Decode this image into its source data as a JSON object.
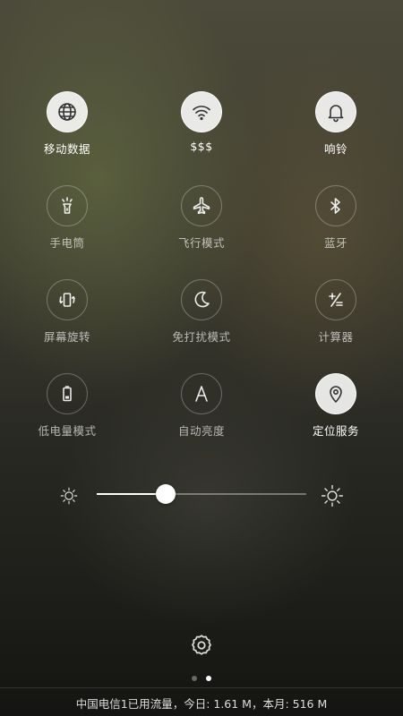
{
  "tiles": [
    {
      "label": "移动数据",
      "icon": "globe-icon",
      "on": true
    },
    {
      "label": "$$$",
      "icon": "wifi-icon",
      "on": true
    },
    {
      "label": "响铃",
      "icon": "bell-icon",
      "on": true
    },
    {
      "label": "手电筒",
      "icon": "flashlight-icon",
      "on": false
    },
    {
      "label": "飞行模式",
      "icon": "airplane-icon",
      "on": false
    },
    {
      "label": "蓝牙",
      "icon": "bluetooth-icon",
      "on": false
    },
    {
      "label": "屏幕旋转",
      "icon": "rotate-screen-icon",
      "on": false
    },
    {
      "label": "免打扰模式",
      "icon": "moon-icon",
      "on": false
    },
    {
      "label": "计算器",
      "icon": "calculator-icon",
      "on": false
    },
    {
      "label": "低电量模式",
      "icon": "battery-low-icon",
      "on": false
    },
    {
      "label": "自动亮度",
      "icon": "auto-brightness-icon",
      "on": false
    },
    {
      "label": "定位服务",
      "icon": "location-icon",
      "on": true
    }
  ],
  "brightness": {
    "level_percent": 33
  },
  "pages": {
    "count": 2,
    "active": 1
  },
  "footer": {
    "usage_text": "中国电信1已用流量，今日: 1.61 M，本月: 516 M"
  },
  "colors": {
    "active_fill": "#e0e0e0",
    "active_icon": "#333333"
  }
}
